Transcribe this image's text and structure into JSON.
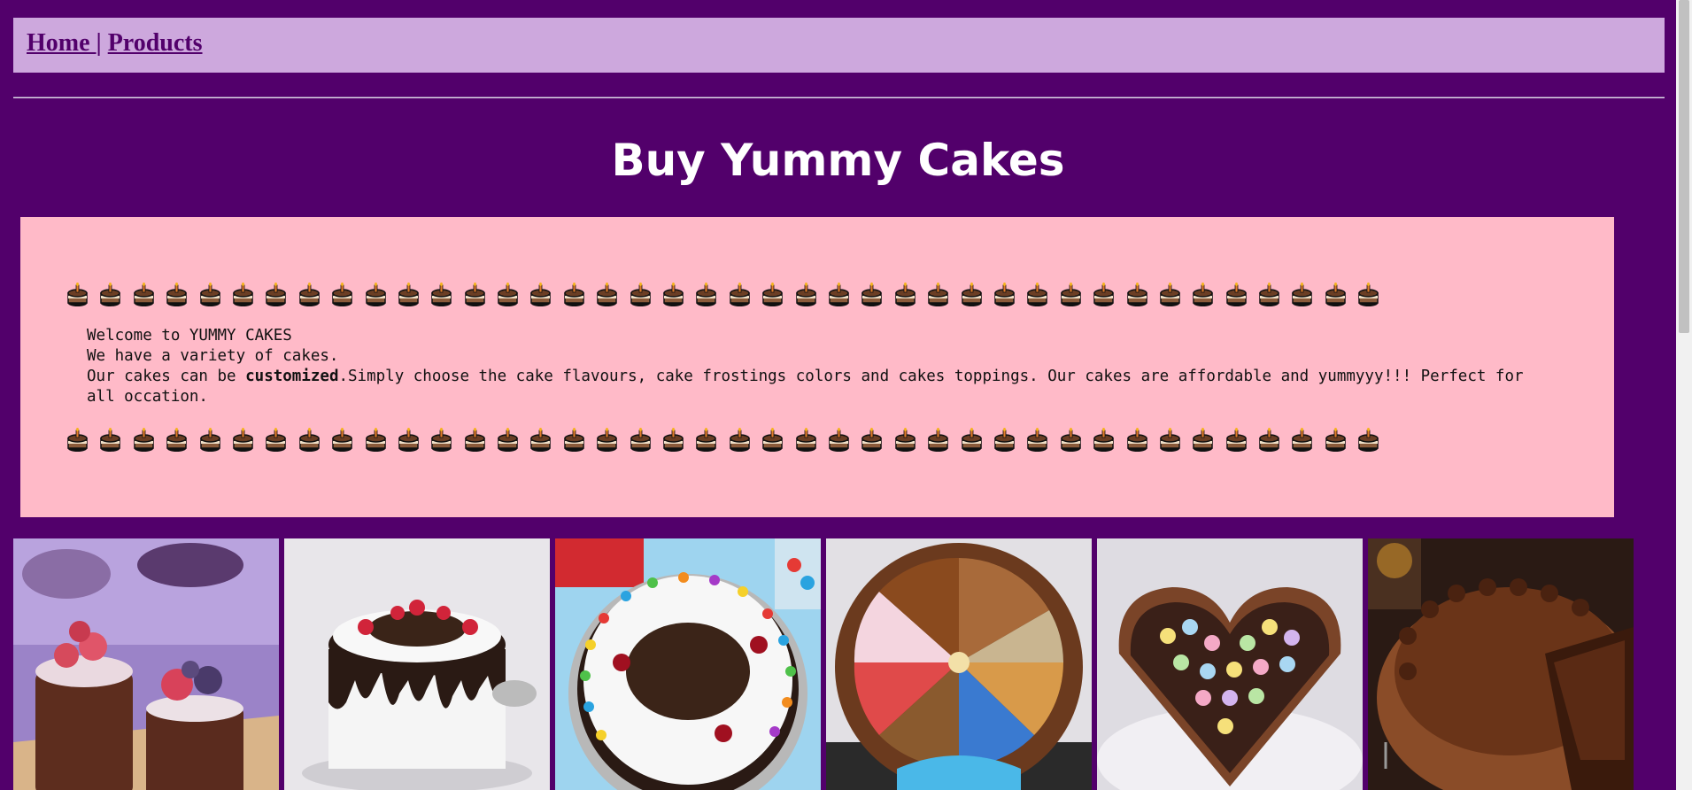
{
  "nav": {
    "home_label": "Home ",
    "separator": "|",
    "products_label": "Products"
  },
  "page_title": "Buy Yummy Cakes",
  "welcome": {
    "line1": "Welcome to YUMMY CAKES",
    "line2": "We have a variety of cakes.",
    "line3_prefix": "Our cakes can be ",
    "line3_bold": "customized",
    "line3_rest": ".Simply choose the cake flavours, cake frostings colors and cakes toppings. Our cakes are affordable and yummyyy!!! Perfect for all occation.",
    "cake_icon_count": 40
  },
  "gallery": {
    "images": [
      {
        "name": "mini-raspberry-chocolate-cakes"
      },
      {
        "name": "black-forest-drip-cake"
      },
      {
        "name": "black-forest-gems-cake"
      },
      {
        "name": "candy-chocolate-fingers-cake"
      },
      {
        "name": "heart-kitkat-gems-cake"
      },
      {
        "name": "chocolate-frosted-cake-slice"
      }
    ]
  },
  "colors": {
    "background": "#52006b",
    "nav_background": "#cda8dd",
    "welcome_background": "#ffbac8",
    "title_text": "#ffffff"
  }
}
